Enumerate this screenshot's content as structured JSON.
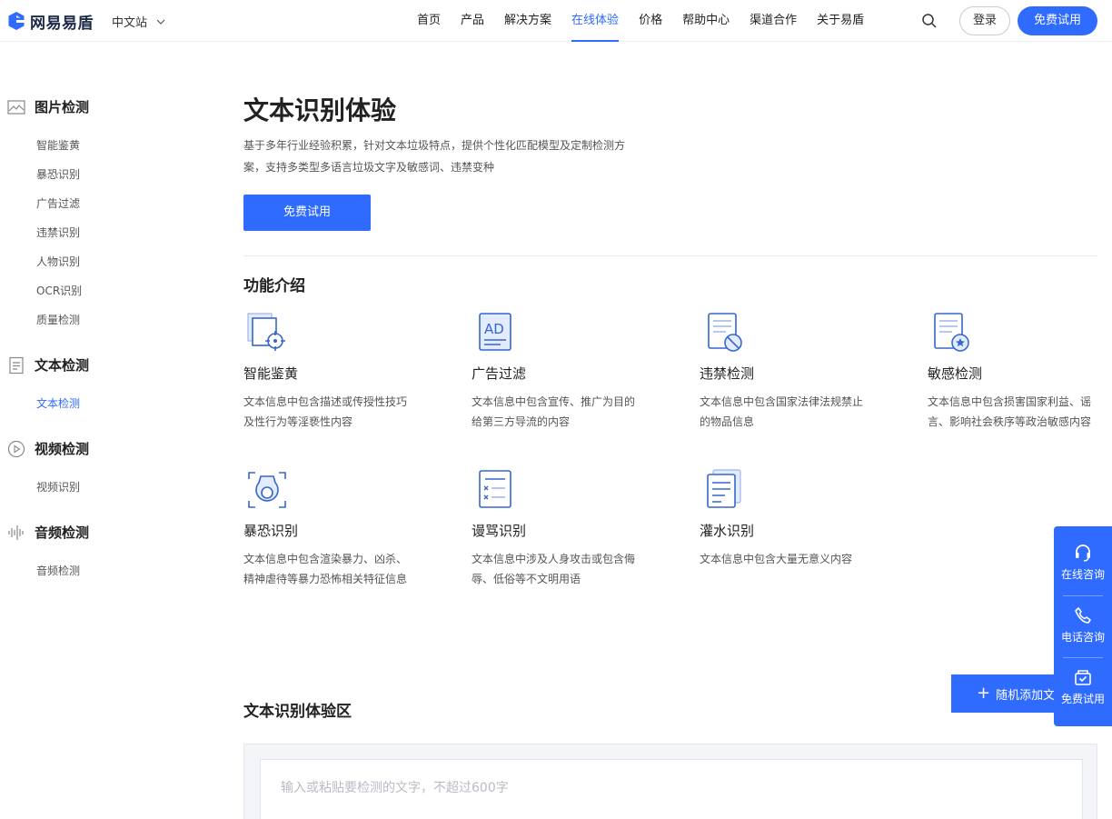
{
  "header": {
    "brand": "网易易盾",
    "site_switch": "中文站",
    "nav": [
      "首页",
      "产品",
      "解决方案",
      "在线体验",
      "价格",
      "帮助中心",
      "渠道合作",
      "关于易盾"
    ],
    "active_nav": "在线体验",
    "login": "登录",
    "trial": "免费试用"
  },
  "sidebar": {
    "categories": [
      {
        "label": "图片检测",
        "icon": "image-icon",
        "items": [
          "智能鉴黄",
          "暴恐识别",
          "广告过滤",
          "违禁识别",
          "人物识别",
          "OCR识别",
          "质量检测"
        ]
      },
      {
        "label": "文本检测",
        "icon": "document-icon",
        "items": [
          "文本检测"
        ]
      },
      {
        "label": "视频检测",
        "icon": "play-icon",
        "items": [
          "视频识别"
        ]
      },
      {
        "label": "音频检测",
        "icon": "waveform-icon",
        "items": [
          "音频检测"
        ]
      }
    ],
    "active_item": "文本检测"
  },
  "main": {
    "title": "文本识别体验",
    "description": "基于多年行业经验积累，针对文本垃圾特点，提供个性化匹配模型及定制检测方案，支持多类型多语言垃圾文字及敏感词、违禁变种",
    "trial_button": "免费试用",
    "section_title": "功能介绍",
    "features": [
      {
        "name": "智能鉴黄",
        "desc": "文本信息中包含描述或传授性技巧及性行为等淫亵性内容",
        "icon": "porn-detect-icon"
      },
      {
        "name": "广告过滤",
        "desc": "文本信息中包含宣传、推广为目的给第三方导流的内容",
        "icon": "ad-filter-icon"
      },
      {
        "name": "违禁检测",
        "desc": "文本信息中包含国家法律法规禁止的物品信息",
        "icon": "prohibited-icon"
      },
      {
        "name": "敏感检测",
        "desc": "文本信息中包含损害国家利益、谣言、影响社会秩序等政治敏感内容",
        "icon": "sensitive-icon"
      },
      {
        "name": "暴恐识别",
        "desc": "文本信息中包含渲染暴力、凶杀、精神虐待等暴力恐怖相关特征信息",
        "icon": "terror-icon"
      },
      {
        "name": "谩骂识别",
        "desc": "文本信息中涉及人身攻击或包含侮辱、低俗等不文明用语",
        "icon": "abuse-icon"
      },
      {
        "name": "灌水识别",
        "desc": "文本信息中包含大量无意义内容",
        "icon": "spam-icon"
      }
    ],
    "experience_title": "文本识别体验区",
    "random_add": "随机添加文本",
    "input_placeholder": "输入或粘贴要检测的文字，不超过600字"
  },
  "float_panel": {
    "items": [
      {
        "label": "在线咨询",
        "icon": "headset-icon"
      },
      {
        "label": "电话咨询",
        "icon": "phone-icon"
      },
      {
        "label": "免费试用",
        "icon": "gift-icon"
      }
    ]
  },
  "colors": {
    "accent": "#2f6bff",
    "text": "#222222",
    "muted": "#555555"
  }
}
